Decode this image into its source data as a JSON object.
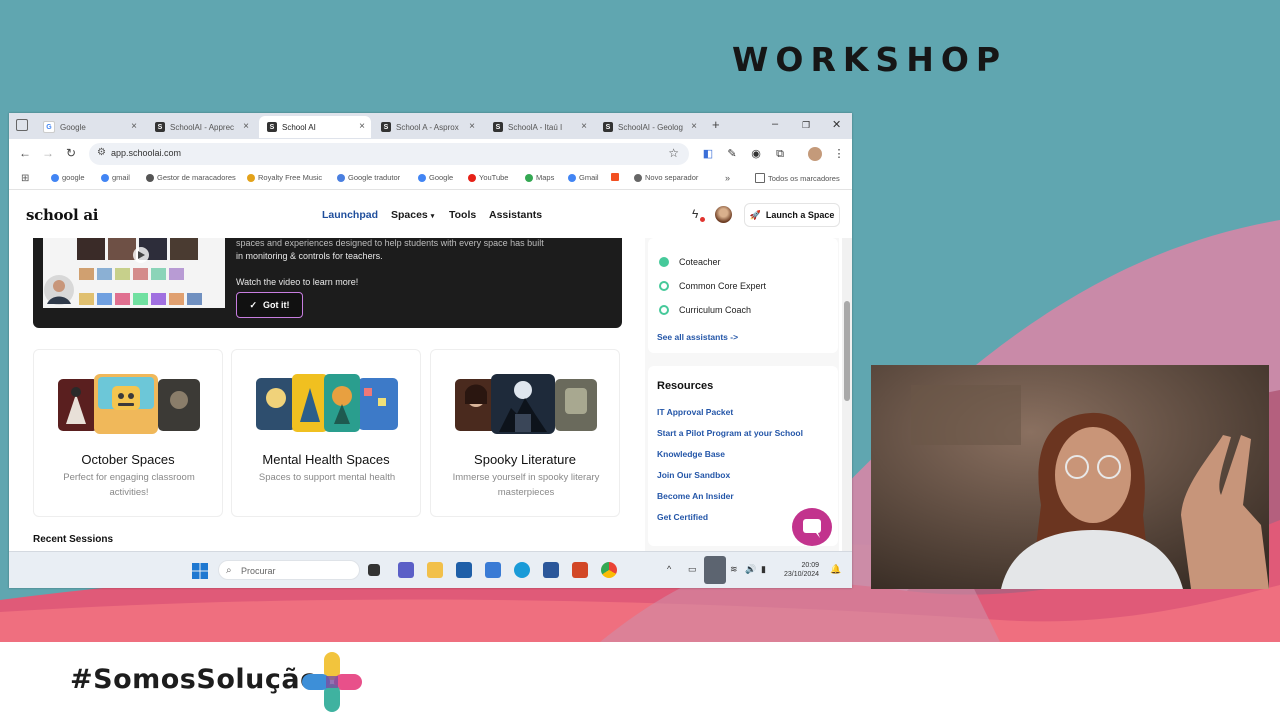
{
  "slide": {
    "title": "WORKSHOP",
    "hashtag": "#SomosSolução"
  },
  "browser": {
    "tabs": [
      {
        "label": "Google",
        "active": false
      },
      {
        "label": "SchoolAI - Apprec",
        "active": false
      },
      {
        "label": "School AI",
        "active": true
      },
      {
        "label": "School A - Asprox",
        "active": false
      },
      {
        "label": "SchoolA - Itaú I",
        "active": false
      },
      {
        "label": "SchoolAI - Geolog",
        "active": false
      }
    ],
    "new_tab": "+",
    "url": "app.schoolai.com",
    "bookmarks": [
      "google",
      "gmail",
      "Gestor de maracadores",
      "Royalty Free Music",
      "Google tradutor",
      "Google",
      "YouTube",
      "Maps",
      "Gmail",
      "Novo separador",
      "Todos os marcadores"
    ]
  },
  "app": {
    "brand": "school ai",
    "nav": [
      "Launchpad",
      "Spaces",
      "Tools",
      "Assistants"
    ],
    "launch_button": "Launch a Space",
    "banner": {
      "text_line1": "spaces and experiences designed to help students with every space has built",
      "text_line2": "in monitoring & controls for teachers.",
      "text_line3": "Watch the video to learn more!",
      "button": "Got it!"
    },
    "cards": [
      {
        "title": "October Spaces",
        "desc": "Perfect for engaging classroom activities!"
      },
      {
        "title": "Mental Health Spaces",
        "desc": "Spaces to support mental health"
      },
      {
        "title": "Spooky Literature",
        "desc": "Immerse yourself in spooky literary masterpieces"
      }
    ],
    "recent_sessions": "Recent Sessions",
    "assistants": {
      "items": [
        "Coteacher",
        "Common Core Expert",
        "Curriculum Coach"
      ],
      "see_all": "See all assistants ->"
    },
    "resources": {
      "title": "Resources",
      "links": [
        "IT Approval Packet",
        "Start a Pilot Program at your School",
        "Knowledge Base",
        "Join Our Sandbox",
        "Become An Insider",
        "Get Certified"
      ]
    }
  },
  "taskbar": {
    "search_placeholder": "Procurar",
    "time": "20:09",
    "date": "23/10/2024"
  },
  "colors": {
    "accent": "#1f4e9c",
    "link": "#2456a8",
    "chat_fab": "#c2338d",
    "banner_bg": "#1c1c1c"
  }
}
